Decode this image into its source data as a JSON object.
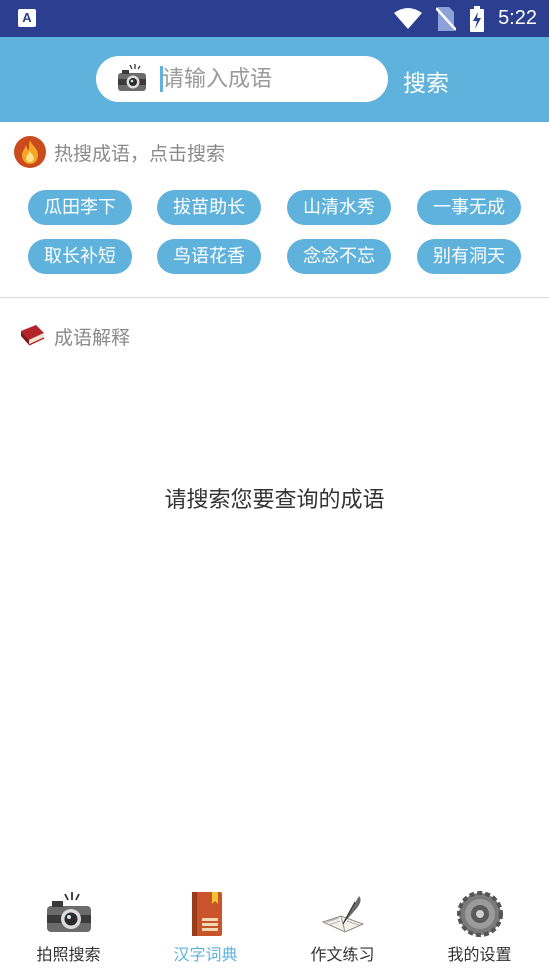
{
  "status_bar": {
    "app_indicator": "A",
    "time": "5:22",
    "icons": [
      "wifi-icon",
      "no-sim-icon",
      "battery-charging-icon"
    ]
  },
  "search": {
    "placeholder": "请输入成语",
    "button_label": "搜索",
    "camera_icon": "camera-icon"
  },
  "hot_section": {
    "title": "热搜成语，点击搜索",
    "icon": "fire-icon",
    "tags": [
      "瓜田李下",
      "拔苗助长",
      "山清水秀",
      "一事无成",
      "取长补短",
      "鸟语花香",
      "念念不忘",
      "别有洞天"
    ]
  },
  "explain_section": {
    "title": "成语解释",
    "icon": "book-icon",
    "empty_hint": "请搜索您要查询的成语"
  },
  "bottom_nav": {
    "items": [
      {
        "label": "拍照搜索",
        "icon": "camera-icon"
      },
      {
        "label": "汉字词典",
        "icon": "dictionary-icon"
      },
      {
        "label": "作文练习",
        "icon": "quill-pen-icon"
      },
      {
        "label": "我的设置",
        "icon": "gear-icon"
      }
    ],
    "active_index": 1
  },
  "colors": {
    "status_bar": "#2c3e8f",
    "accent": "#5fb2dc",
    "fire": "#c94b1e"
  }
}
